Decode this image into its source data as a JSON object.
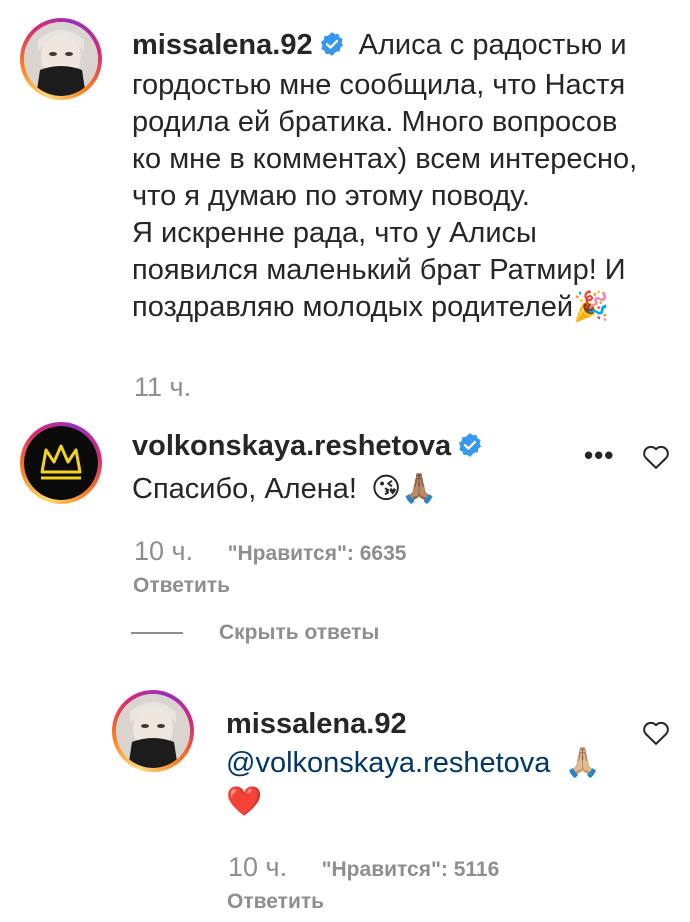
{
  "post_caption": {
    "username": "missalena.92",
    "lines": [
      "Алиса с радостью и",
      "гордостью мне сообщила, что Настя",
      "родила ей братика. Много вопросов",
      "ко мне в комментах) всем интересно,",
      "что я думаю по этому поводу.",
      "Я искренне рада, что у Алисы",
      "появился маленький брат Ратмир! И",
      "поздравляю молодых родителей"
    ],
    "emoji_party": "🎉",
    "time": "11 ч."
  },
  "comment": {
    "username": "volkonskaya.reshetova",
    "text": "Спасибо, Алена!",
    "emojis": "😘🙏🏽",
    "time": "10 ч.",
    "likes": "\"Нравится\": 6635",
    "reply_label": "Ответить",
    "more_label": "•••",
    "hide_replies_label": "Скрыть ответы"
  },
  "reply": {
    "username": "missalena.92",
    "mention": "@volkonskaya.reshetova",
    "emojis": "🙏🏼",
    "heart_emoji": "❤️",
    "time": "10 ч.",
    "likes": "\"Нравится\": 5116",
    "reply_label": "Ответить"
  },
  "colors": {
    "text": "#262626",
    "secondary": "#8e8e8e",
    "verified": "#3897f0",
    "mention": "#00376b"
  }
}
